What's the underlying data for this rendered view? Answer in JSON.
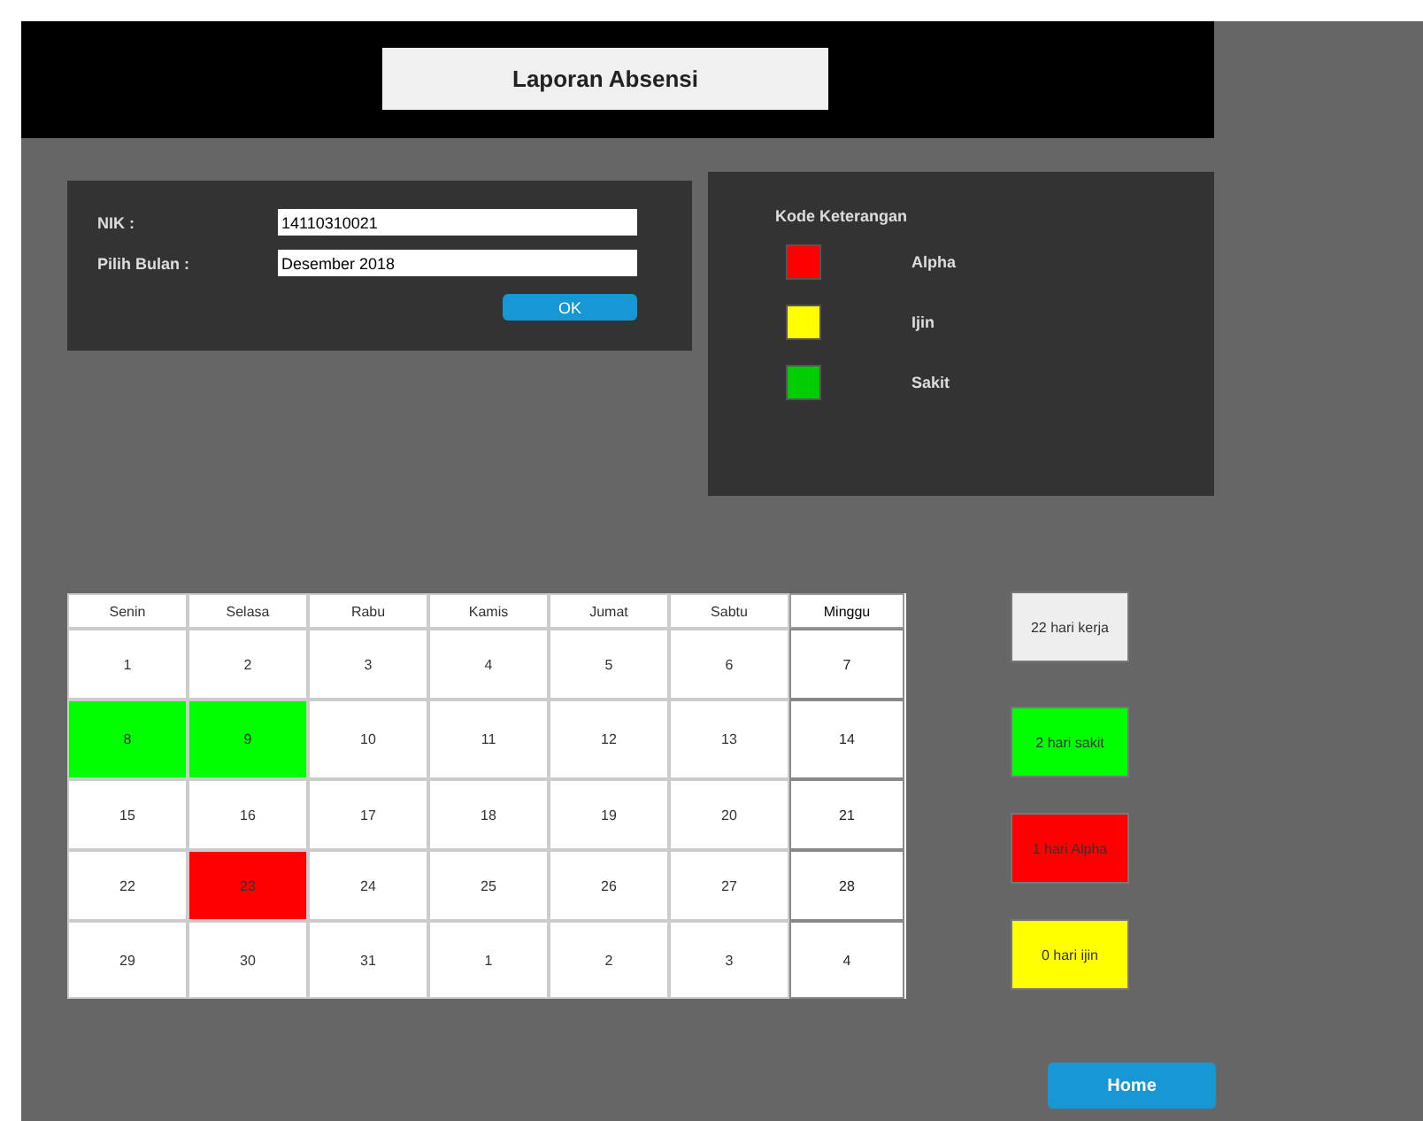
{
  "header": {
    "title": "Laporan Absensi"
  },
  "form": {
    "fields": [
      {
        "label": "NIK :",
        "value": "14110310021"
      },
      {
        "label": "Pilih Bulan :",
        "value": "Desember 2018"
      }
    ],
    "button": "OK"
  },
  "legend": {
    "title": "Kode Keterangan",
    "items": [
      {
        "label": "Alpha",
        "color": "#ff0000"
      },
      {
        "label": "Ijin",
        "color": "#ffff00"
      },
      {
        "label": "Sakit",
        "color": "#00cc00"
      }
    ]
  },
  "calendar": {
    "columns": [
      {
        "label": "Senin",
        "kind": "weekday"
      },
      {
        "label": "Selasa",
        "kind": "weekday"
      },
      {
        "label": "Rabu",
        "kind": "weekday"
      },
      {
        "label": "Kamis",
        "kind": "weekday"
      },
      {
        "label": "Jumat",
        "kind": "weekday"
      },
      {
        "label": "Sabtu",
        "kind": "weekday"
      },
      {
        "label": "Minggu",
        "kind": "sunday"
      }
    ],
    "rows": [
      [
        {
          "day": "1"
        },
        {
          "day": "2"
        },
        {
          "day": "3"
        },
        {
          "day": "4"
        },
        {
          "day": "5"
        },
        {
          "day": "6"
        },
        {
          "day": "7"
        }
      ],
      [
        {
          "day": "8",
          "color": "#00ff00"
        },
        {
          "day": "9",
          "color": "#00ff00"
        },
        {
          "day": "10"
        },
        {
          "day": "11"
        },
        {
          "day": "12"
        },
        {
          "day": "13"
        },
        {
          "day": "14"
        }
      ],
      [
        {
          "day": "15"
        },
        {
          "day": "16"
        },
        {
          "day": "17"
        },
        {
          "day": "18"
        },
        {
          "day": "19"
        },
        {
          "day": "20"
        },
        {
          "day": "21"
        }
      ],
      [
        {
          "day": "22"
        },
        {
          "day": "23",
          "color": "#ff0000"
        },
        {
          "day": "24"
        },
        {
          "day": "25"
        },
        {
          "day": "26"
        },
        {
          "day": "27"
        },
        {
          "day": "28"
        }
      ],
      [
        {
          "day": "29"
        },
        {
          "day": "30"
        },
        {
          "day": "31"
        },
        {
          "day": "1"
        },
        {
          "day": "2"
        },
        {
          "day": "3"
        },
        {
          "day": "4"
        }
      ]
    ]
  },
  "summary": [
    {
      "label": "22 hari kerja",
      "color": "#eeeeee"
    },
    {
      "label": "2 hari sakit",
      "color": "#00ff00"
    },
    {
      "label": "1 hari Alpha",
      "color": "#ff0000"
    },
    {
      "label": "0 hari ijin",
      "color": "#ffff00"
    }
  ],
  "home_button": "Home"
}
